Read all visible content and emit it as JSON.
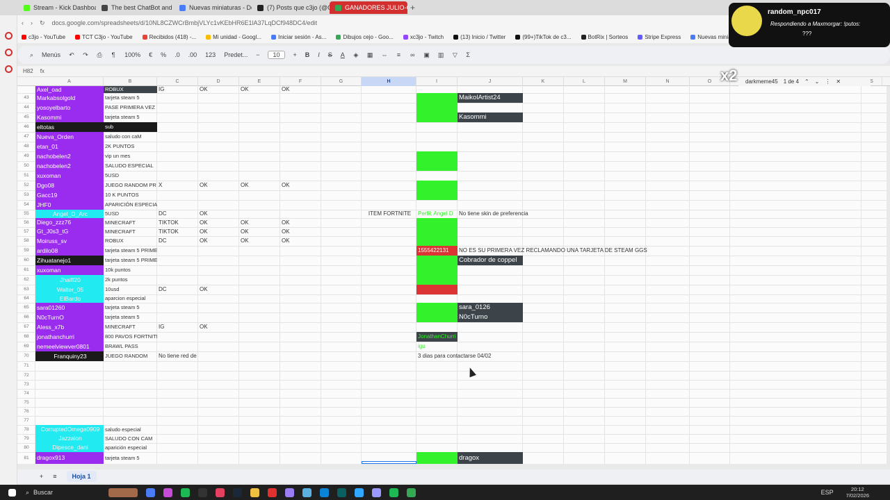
{
  "tabs": [
    {
      "label": "Stream - Kick Dashboard",
      "color": "#53fc18"
    },
    {
      "label": "The best ChatBot and Wi",
      "color": "#444444"
    },
    {
      "label": "Nuevas miniaturas - Docu",
      "color": "#4a7cf5"
    },
    {
      "label": "(7) Posts que c3jo (@C3jo",
      "color": "#222222"
    },
    {
      "label": "GANADORES JULIO-OCT",
      "color": "#34a853",
      "active": true
    }
  ],
  "new_tab": "+",
  "url": "docs.google.com/spreadsheets/d/10NL8CZWCrBmbjVLYc1vKEbHR6E1lA37LqDCf948DC4/edit",
  "bookmarks": [
    {
      "label": "c3jo - YouTube",
      "color": "#ff0000"
    },
    {
      "label": "TCT C3jo - YouTube",
      "color": "#ff0000"
    },
    {
      "label": "Recibidos (418) -...",
      "color": "#ea4335"
    },
    {
      "label": "Mi unidad - Googl...",
      "color": "#fbbc04"
    },
    {
      "label": "Iniciar sesión - As...",
      "color": "#4a7cf5"
    },
    {
      "label": "Dibujos cejo - Goo...",
      "color": "#34a853"
    },
    {
      "label": "xc3jo - Twitch",
      "color": "#9146ff"
    },
    {
      "label": "(13) Inicio / Twitter",
      "color": "#111111"
    },
    {
      "label": "(99+)TikTok de c3...",
      "color": "#111111"
    },
    {
      "label": "BotRix | Sorteos",
      "color": "#222222"
    },
    {
      "label": "Stripe Express",
      "color": "#635bff"
    },
    {
      "label": "Nuevas miniaturas...",
      "color": "#4a7cf5"
    }
  ],
  "toolbar": {
    "menus": "Menús",
    "zoom": "100%",
    "currency": "€",
    "percent": "%",
    "dec_less": ".0",
    "dec_more": ".00",
    "number_fmt": "123",
    "font": "Predet...",
    "font_size": "10",
    "minus": "−",
    "plus": "+",
    "bold": "B",
    "italic": "I",
    "strike": "S",
    "underline_a": "A",
    "sigma": "Σ"
  },
  "name_box": "H82",
  "fx": "fx",
  "columns": [
    "A",
    "B",
    "C",
    "D",
    "E",
    "F",
    "G",
    "H",
    "I",
    "J",
    "K",
    "L",
    "M",
    "N",
    "O",
    "P",
    "S"
  ],
  "selected_column": "H",
  "search": {
    "query": "darkmeme45",
    "count": "1 de 4"
  },
  "overlay": {
    "user": "random_npc017",
    "message": "Respondiendo a Maxmorgar: !putos:",
    "emote_text": "???",
    "multiplier": "x2"
  },
  "rows": [
    {
      "n": "",
      "a": "Axel_oad",
      "ac": "purple",
      "b": "ROBUX",
      "bc": "dark",
      "c": "IG",
      "d": "OK",
      "e": "OK",
      "f": "OK"
    },
    {
      "n": "43",
      "a": "Markabsolgold",
      "ac": "purple",
      "b": "tarjeta steam 5",
      "i": "green",
      "j": "MaikolArtist24",
      "jc": "dark"
    },
    {
      "n": "44",
      "a": "yosoyelbarto",
      "ac": "purple",
      "b": "PASE PRIMERA VEZ",
      "i": "green"
    },
    {
      "n": "45",
      "a": "Kasommi",
      "ac": "purple",
      "b": "tarjeta steam 5",
      "i": "green",
      "j": "Kasommi",
      "jc": "dark"
    },
    {
      "n": "46",
      "a": "eltotas",
      "ac": "black",
      "b": "sub",
      "bc": "black"
    },
    {
      "n": "47",
      "a": "Nueva_Orden",
      "ac": "purple",
      "b": "saludo con caM"
    },
    {
      "n": "48",
      "a": "etan_01",
      "ac": "purple",
      "b": "2K PUNTOS"
    },
    {
      "n": "49",
      "a": "nachobelen2",
      "ac": "purple",
      "b": "vip un mes",
      "i": "green"
    },
    {
      "n": "50",
      "a": "nachobelen2",
      "ac": "purple",
      "b": "SALUDO ESPECIAL",
      "i": "green"
    },
    {
      "n": "51",
      "a": "xuxoman",
      "ac": "purple",
      "b": "5USD"
    },
    {
      "n": "52",
      "a": "Dgo08",
      "ac": "purple",
      "b": "JUEGO RANDOM PR",
      "c": "X",
      "d": "OK",
      "e": "OK",
      "f": "OK",
      "i": "green"
    },
    {
      "n": "53",
      "a": "Gacc19",
      "ac": "purple",
      "b": "10 K PUNTOS",
      "i": "green"
    },
    {
      "n": "54",
      "a": "JHF0",
      "ac": "purple",
      "b": "APARICIÓN ESPECIAL"
    },
    {
      "n": "55",
      "a": "Angel_D_Arc",
      "ac": "cyan",
      "b": "5USD",
      "c": "DC",
      "d": "OK",
      "h": "ITEM FORTNITE",
      "i": "text-green",
      "it": "Perfil: Angel D",
      "j": "No tiene skin de preferencia",
      "jc": "plain"
    },
    {
      "n": "56",
      "a": "Diego_zzz76",
      "ac": "purple",
      "b": "MINECRAFT",
      "c": "TIKTOK",
      "d": "OK",
      "e": "OK",
      "f": "OK",
      "i": "green"
    },
    {
      "n": "57",
      "a": "Gt_J0s3_tG",
      "ac": "purple",
      "b": "MINECRAFT",
      "c": "TIKTOK",
      "d": "OK",
      "e": "OK",
      "f": "OK",
      "i": "green"
    },
    {
      "n": "58",
      "a": "Moiruss_sv",
      "ac": "purple",
      "b": "ROBUX",
      "c": "DC",
      "d": "OK",
      "e": "OK",
      "f": "OK",
      "i": "green"
    },
    {
      "n": "59",
      "a": "ardilo08",
      "ac": "purple",
      "b": "tarjeta steam 5 PRIMERA VEZ",
      "i": "red",
      "it": "1555422131",
      "j": "NO ES SU PRIMERA VEZ RECLAMANDO UNA TARJETA DE STEAM GGS",
      "jc": "plain"
    },
    {
      "n": "60",
      "a": "Zihuatanejo1",
      "ac": "black",
      "b": "tarjeta steam 5 PRIMERA VEZ",
      "i": "green",
      "j": "Cobrador de coppel",
      "jc": "dark"
    },
    {
      "n": "61",
      "a": "xuxoman",
      "ac": "purple",
      "b": "10k puntos",
      "i": "green"
    },
    {
      "n": "62",
      "a": "Jhaiff20",
      "ac": "cyan",
      "b": "2k puntos",
      "i": "green"
    },
    {
      "n": "63",
      "a": "Walter_05",
      "ac": "cyan",
      "b": "10usd",
      "c": "DC",
      "d": "OK",
      "i": "red"
    },
    {
      "n": "64",
      "a": "ElBardo",
      "ac": "cyan",
      "b": "aparcion especial"
    },
    {
      "n": "65",
      "a": "sara01260",
      "ac": "purple",
      "b": "tarjeta steam 5",
      "i": "green",
      "j": "sara_0126",
      "jc": "dark"
    },
    {
      "n": "66",
      "a": "N0cTurnO",
      "ac": "purple",
      "b": "tarjeta steam 5",
      "i": "green",
      "j": "N0cTurno",
      "jc": "dark"
    },
    {
      "n": "67",
      "a": "Aless_x7b",
      "ac": "purple",
      "b": "MINECRAFT",
      "c": "IG",
      "d": "OK"
    },
    {
      "n": "68",
      "a": "jonathanchurri",
      "ac": "purple",
      "b": "800 PAVOS FORTNITE",
      "i": "dark-green-text",
      "it": "JonathanChurri"
    },
    {
      "n": "69",
      "a": "nemeelviewver0801",
      "ac": "purple",
      "b": "BRAWL PASS",
      "i": "text-green",
      "it": "igu"
    },
    {
      "n": "70",
      "a": "Franquiny23",
      "ac": "black",
      "b": "JUEGO RANDOM",
      "c": "No tiene red de contacto",
      "i": "plain",
      "it": "3 dias para contactarse 04/02"
    },
    {
      "n": "71"
    },
    {
      "n": "72"
    },
    {
      "n": "73"
    },
    {
      "n": "74"
    },
    {
      "n": "75"
    },
    {
      "n": "76"
    },
    {
      "n": "77"
    },
    {
      "n": "78",
      "a": "CorruptedOmega0909",
      "ac": "cyan",
      "b": "saludo especial"
    },
    {
      "n": "79",
      "a": "Jazzalon",
      "ac": "cyan",
      "b": "SALUDO CON CAM"
    },
    {
      "n": "80",
      "a": "Dipesce_dani",
      "ac": "cyan",
      "b": "aparición especial"
    },
    {
      "n": "81",
      "a": "dragox913",
      "ac": "purple",
      "b": "tarjeta steam 5",
      "i": "green",
      "j": "dragox",
      "jc": "dark"
    }
  ],
  "sheet": {
    "add": "+",
    "list": "≡",
    "name": "Hoja 1"
  },
  "taskbar": {
    "search": "Buscar",
    "lang": "ESP",
    "time": "20:12",
    "date": "7/02/2026"
  },
  "colors": {
    "purple": "#9a2cf0",
    "cyan": "#21eaf0",
    "green": "#33f22b",
    "red": "#dc3434",
    "dark": "#3d4449",
    "black": "#1a1a1a",
    "accent": "#d32f2f",
    "selected_col": "#c8d7f5"
  }
}
